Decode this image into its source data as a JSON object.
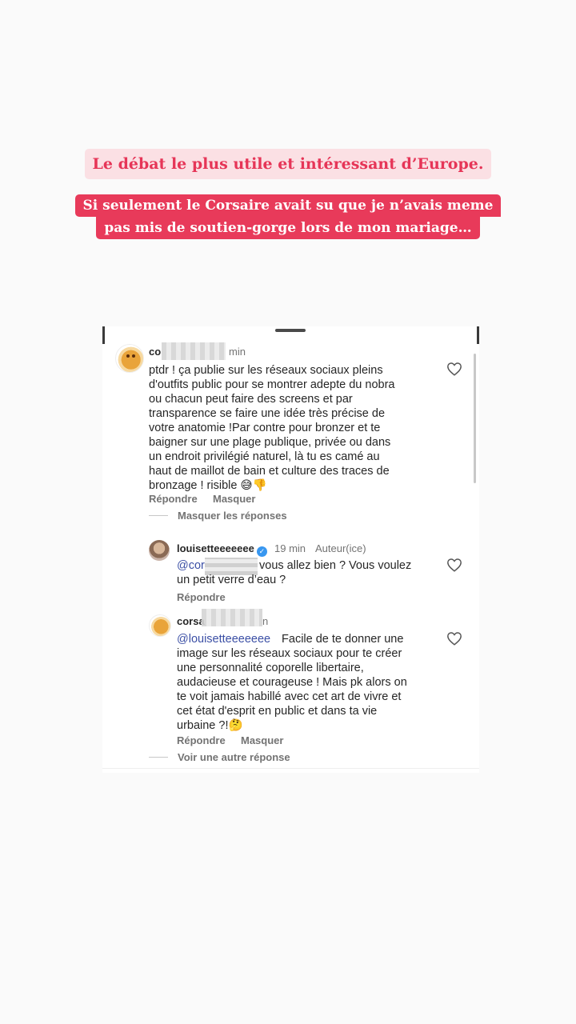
{
  "captions": {
    "line1": "Le débat le plus utile et intéressant d’Europe.",
    "line2a": "Si seulement le Corsaire avait su que je n’avais meme",
    "line2b": "pas mis de soutien-gorge lors de mon mariage…"
  },
  "comments": [
    {
      "username_visible": "co",
      "time_suffix": "min",
      "text": "ptdr ! ça publie sur les réseaux sociaux pleins\nd'outfits public pour se montrer adepte du nobra\nou chacun peut faire des screens et par\ntransparence se faire une idée très précise de\nvotre anatomie !Par contre pour bronzer et te\nbaigner sur une plage publique,  privée ou dans\nun  endroit privilégié naturel, là tu es camé au\nhaut de maillot de bain et culture des traces de\nbronzage ! risible 😅👎",
      "reply_label": "Répondre",
      "hide_label": "Masquer",
      "hide_replies_label": "Masquer les réponses"
    },
    {
      "username": "louisetteeeeeee",
      "time": "19 min",
      "author_badge": "Auteur(ice)",
      "mention": "@cors",
      "text": "vous allez bien ? Vous voulez\nun petit verre d’eau ?",
      "reply_label": "Répondre"
    },
    {
      "username_visible": "corsa",
      "time_suffix": "n",
      "mention": "@louisetteeeeeee",
      "text_first_line": " Facile de te donner une",
      "text": "image sur les réseaux sociaux pour te créer\nune personnalité coporelle libertaire,\naudacieuse et courageuse ! Mais pk alors on\nte voit jamais habillé avec cet art de vivre et\ncet état d'esprit en public et dans ta vie\nurbaine ?!🤔",
      "reply_label": "Répondre",
      "hide_label": "Masquer",
      "more_replies_label": "Voir une autre réponse"
    }
  ],
  "icons": {
    "heart": "heart-outline-icon",
    "verified": "verified-badge-icon"
  },
  "colors": {
    "caption_pink_bg": "#fbe0e4",
    "caption_pink_text": "#e63557",
    "caption_red_bg": "#e83a5a",
    "mention": "#3b4fa5"
  }
}
